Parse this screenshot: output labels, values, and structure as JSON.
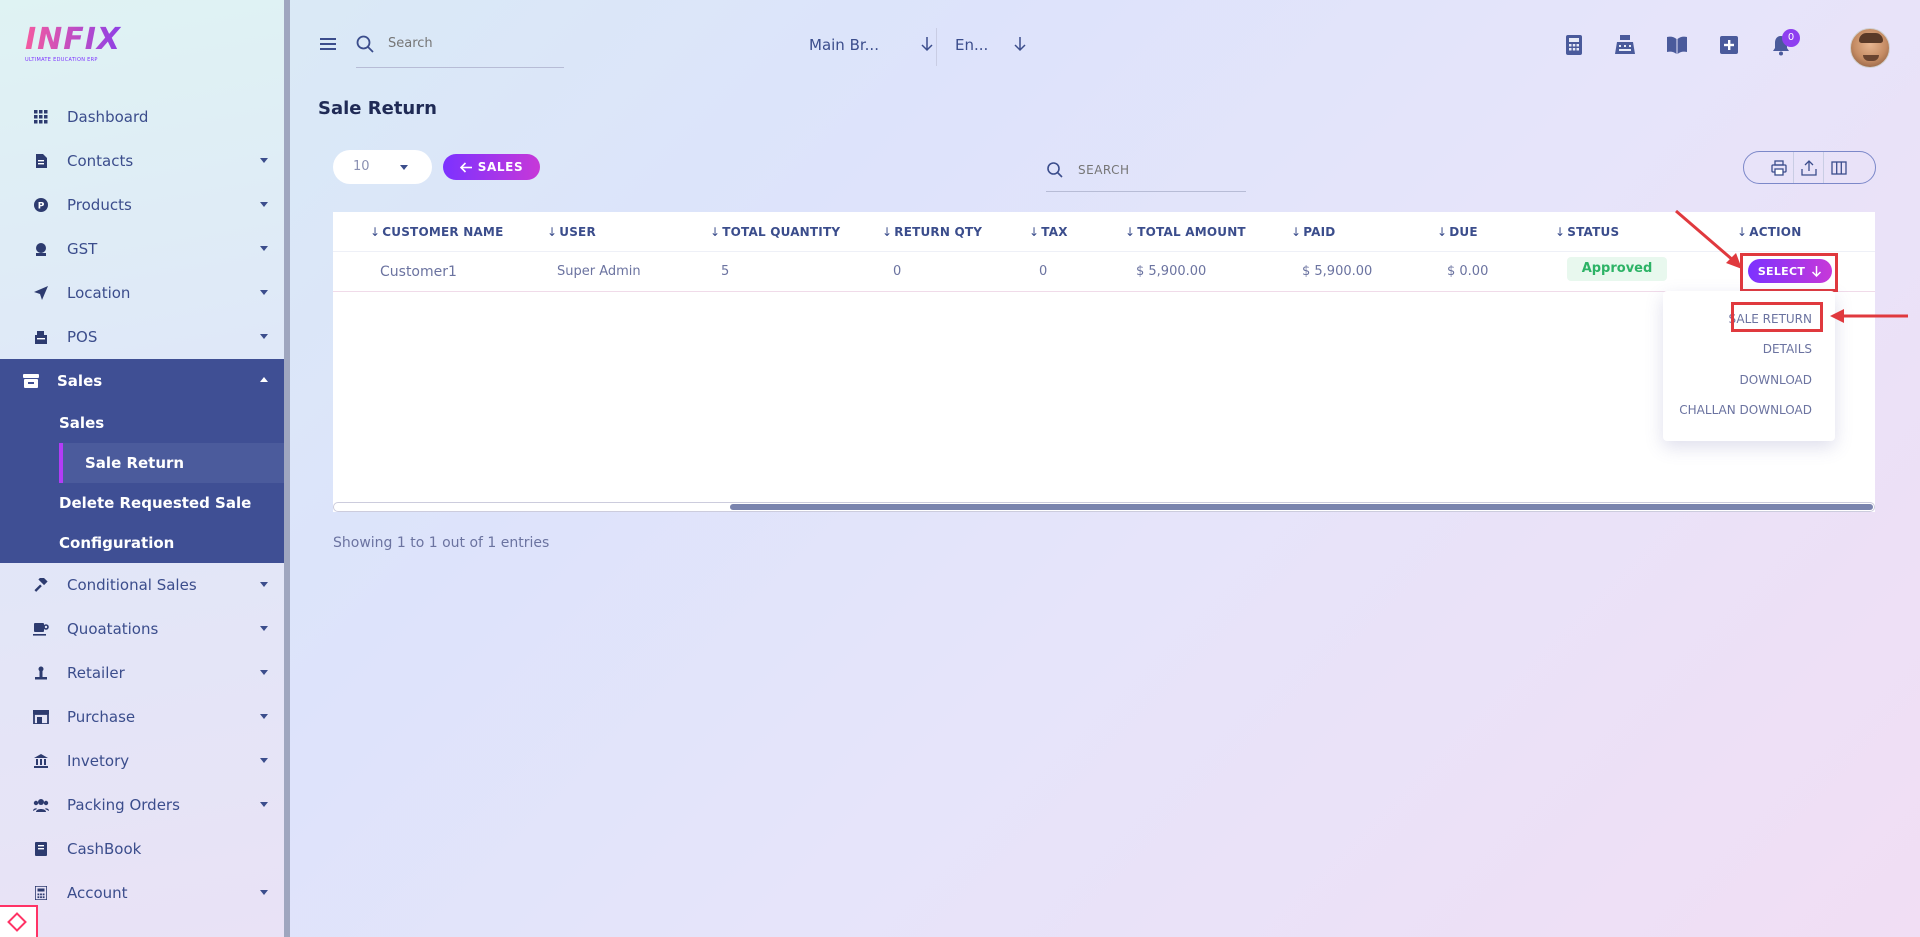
{
  "logo": {
    "name": "INFIX",
    "tagline": "ULTIMATE EDUCATION ERP"
  },
  "sidebar": {
    "items": [
      {
        "label": "Dashboard",
        "icon": "grid-icon",
        "has_caret": false
      },
      {
        "label": "Contacts",
        "icon": "contacts-icon",
        "has_caret": true
      },
      {
        "label": "Products",
        "icon": "products-icon",
        "has_caret": true
      },
      {
        "label": "GST",
        "icon": "gst-icon",
        "has_caret": true
      },
      {
        "label": "Location",
        "icon": "location-icon",
        "has_caret": true
      },
      {
        "label": "POS",
        "icon": "pos-icon",
        "has_caret": true
      }
    ],
    "active_group": {
      "label": "Sales",
      "icon": "store-icon",
      "sub_items": [
        {
          "label": "Sales",
          "active": false
        },
        {
          "label": "Sale Return",
          "active": true
        },
        {
          "label": "Delete Requested Sale",
          "active": false
        },
        {
          "label": "Configuration",
          "active": false
        }
      ]
    },
    "items_after": [
      {
        "label": "Conditional Sales",
        "icon": "gavel-icon",
        "has_caret": true
      },
      {
        "label": "Quoatations",
        "icon": "coffee-icon",
        "has_caret": true
      },
      {
        "label": "Retailer",
        "icon": "retailer-icon",
        "has_caret": true
      },
      {
        "label": "Purchase",
        "icon": "shop-icon",
        "has_caret": true
      },
      {
        "label": "Invetory",
        "icon": "bank-icon",
        "has_caret": true
      },
      {
        "label": "Packing Orders",
        "icon": "users-icon",
        "has_caret": true
      },
      {
        "label": "CashBook",
        "icon": "book-icon",
        "has_caret": false
      },
      {
        "label": "Account",
        "icon": "calculator-icon",
        "has_caret": true
      }
    ]
  },
  "topbar": {
    "search_placeholder": "Search",
    "branch": "Main Br...",
    "language": "En...",
    "notification_count": "0",
    "icons": [
      "calculator-icon",
      "cash-register-icon",
      "book-icon",
      "plus-square-icon",
      "bell-icon"
    ]
  },
  "page": {
    "title": "Sale Return",
    "entries_value": "10",
    "sales_button": "SALES",
    "table_search_placeholder": "SEARCH",
    "tool_icons": [
      "print-icon",
      "export-icon",
      "columns-icon"
    ]
  },
  "table": {
    "columns": [
      "CUSTOMER NAME",
      "USER",
      "TOTAL QUANTITY",
      "RETURN QTY",
      "TAX",
      "TOTAL AMOUNT",
      "PAID",
      "DUE",
      "STATUS",
      "ACTION"
    ],
    "rows": [
      {
        "customer": "Customer1",
        "user": "Super Admin",
        "total_quantity": "5",
        "return_qty": "0",
        "tax": "0",
        "total_amount": "$ 5,900.00",
        "paid": "$ 5,900.00",
        "due": "$ 0.00",
        "status": "Approved",
        "action": "SELECT"
      }
    ]
  },
  "action_menu": {
    "items": [
      "SALE RETURN",
      "DETAILS",
      "DOWNLOAD",
      "CHALLAN DOWNLOAD"
    ]
  },
  "footer": {
    "entries_info": "Showing 1 to 1 out of 1 entries"
  },
  "colors": {
    "accent": "#7c32ff",
    "sidebar_active": "#3f4f94",
    "status_green": "#2db366",
    "highlight_red": "#e0393e"
  }
}
